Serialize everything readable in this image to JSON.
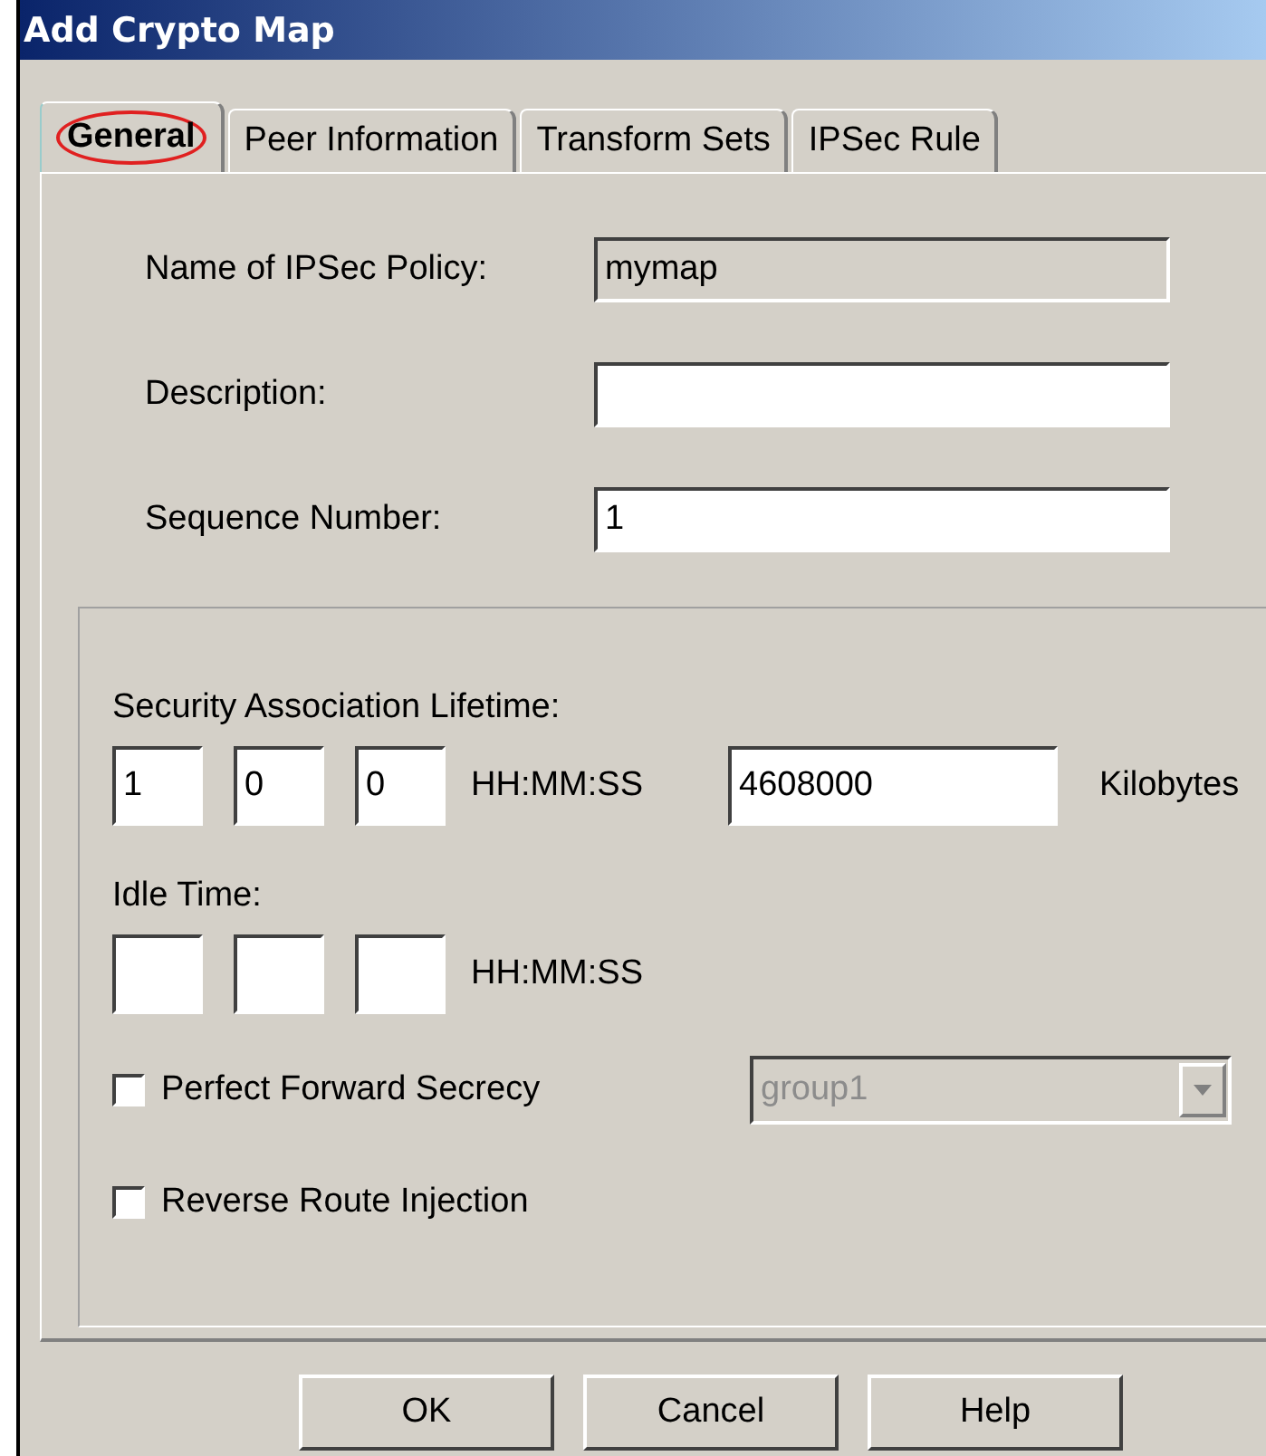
{
  "window": {
    "title": "Add Crypto Map"
  },
  "tabs": [
    {
      "label": "General",
      "selected": true
    },
    {
      "label": "Peer Information",
      "selected": false
    },
    {
      "label": "Transform Sets",
      "selected": false
    },
    {
      "label": "IPSec Rule",
      "selected": false
    }
  ],
  "fields": [
    {
      "label": "Name of IPSec Policy:",
      "value": "mymap",
      "disabled": true
    },
    {
      "label": "Description:",
      "disabled": false
    },
    {
      "label": "Sequence Number:",
      "value": "1",
      "disabled": false
    }
  ],
  "lifetime": {
    "label": "Security Association Lifetime:",
    "time": [
      "1",
      "0",
      "0"
    ],
    "time_unit": "HH:MM:SS",
    "kilobytes": "4608000",
    "kilobytes_unit": "Kilobytes"
  },
  "idle_time": {
    "label": "Idle Time:",
    "time_unit": "HH:MM:SS"
  },
  "options": [
    {
      "kind": "combo",
      "label": "Perfect Forward Secrecy",
      "checked": false,
      "combo": {
        "value": "group1",
        "disabled": true
      }
    },
    {
      "kind": "plain",
      "label": "Reverse Route Injection",
      "checked": false
    }
  ],
  "buttons": [
    "OK",
    "Cancel",
    "Help"
  ]
}
